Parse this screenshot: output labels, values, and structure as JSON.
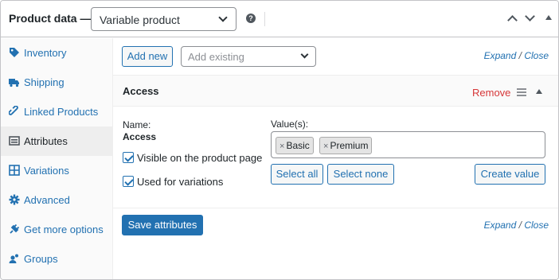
{
  "header": {
    "title": "Product data —",
    "product_type": "Variable product",
    "help_glyph": "?"
  },
  "sidebar": {
    "items": [
      {
        "label": "Inventory",
        "icon": "tag-icon"
      },
      {
        "label": "Shipping",
        "icon": "truck-icon"
      },
      {
        "label": "Linked Products",
        "icon": "link-icon"
      },
      {
        "label": "Attributes",
        "icon": "list-icon",
        "active": true
      },
      {
        "label": "Variations",
        "icon": "grid-icon"
      },
      {
        "label": "Advanced",
        "icon": "gear-icon"
      },
      {
        "label": "Get more options",
        "icon": "plugin-icon"
      },
      {
        "label": "Groups",
        "icon": "groups-icon"
      }
    ]
  },
  "toolbar": {
    "add_new": "Add new",
    "add_existing_placeholder": "Add existing",
    "expand": "Expand",
    "slash": "/",
    "close": "Close"
  },
  "attribute": {
    "name": "Access",
    "remove": "Remove",
    "name_label": "Name:",
    "name_value": "Access",
    "values_label": "Value(s):",
    "values": [
      "Basic",
      "Premium"
    ],
    "tag_remove_glyph": "×",
    "visible_label": "Visible on the product page",
    "visible_checked": true,
    "variations_label": "Used for variations",
    "variations_checked": true,
    "select_all": "Select all",
    "select_none": "Select none",
    "create_value": "Create value"
  },
  "footer": {
    "save": "Save attributes",
    "expand": "Expand",
    "slash": "/",
    "close": "Close"
  },
  "colors": {
    "accent": "#2271b1",
    "danger": "#d63638",
    "border": "#c3c4c7"
  }
}
